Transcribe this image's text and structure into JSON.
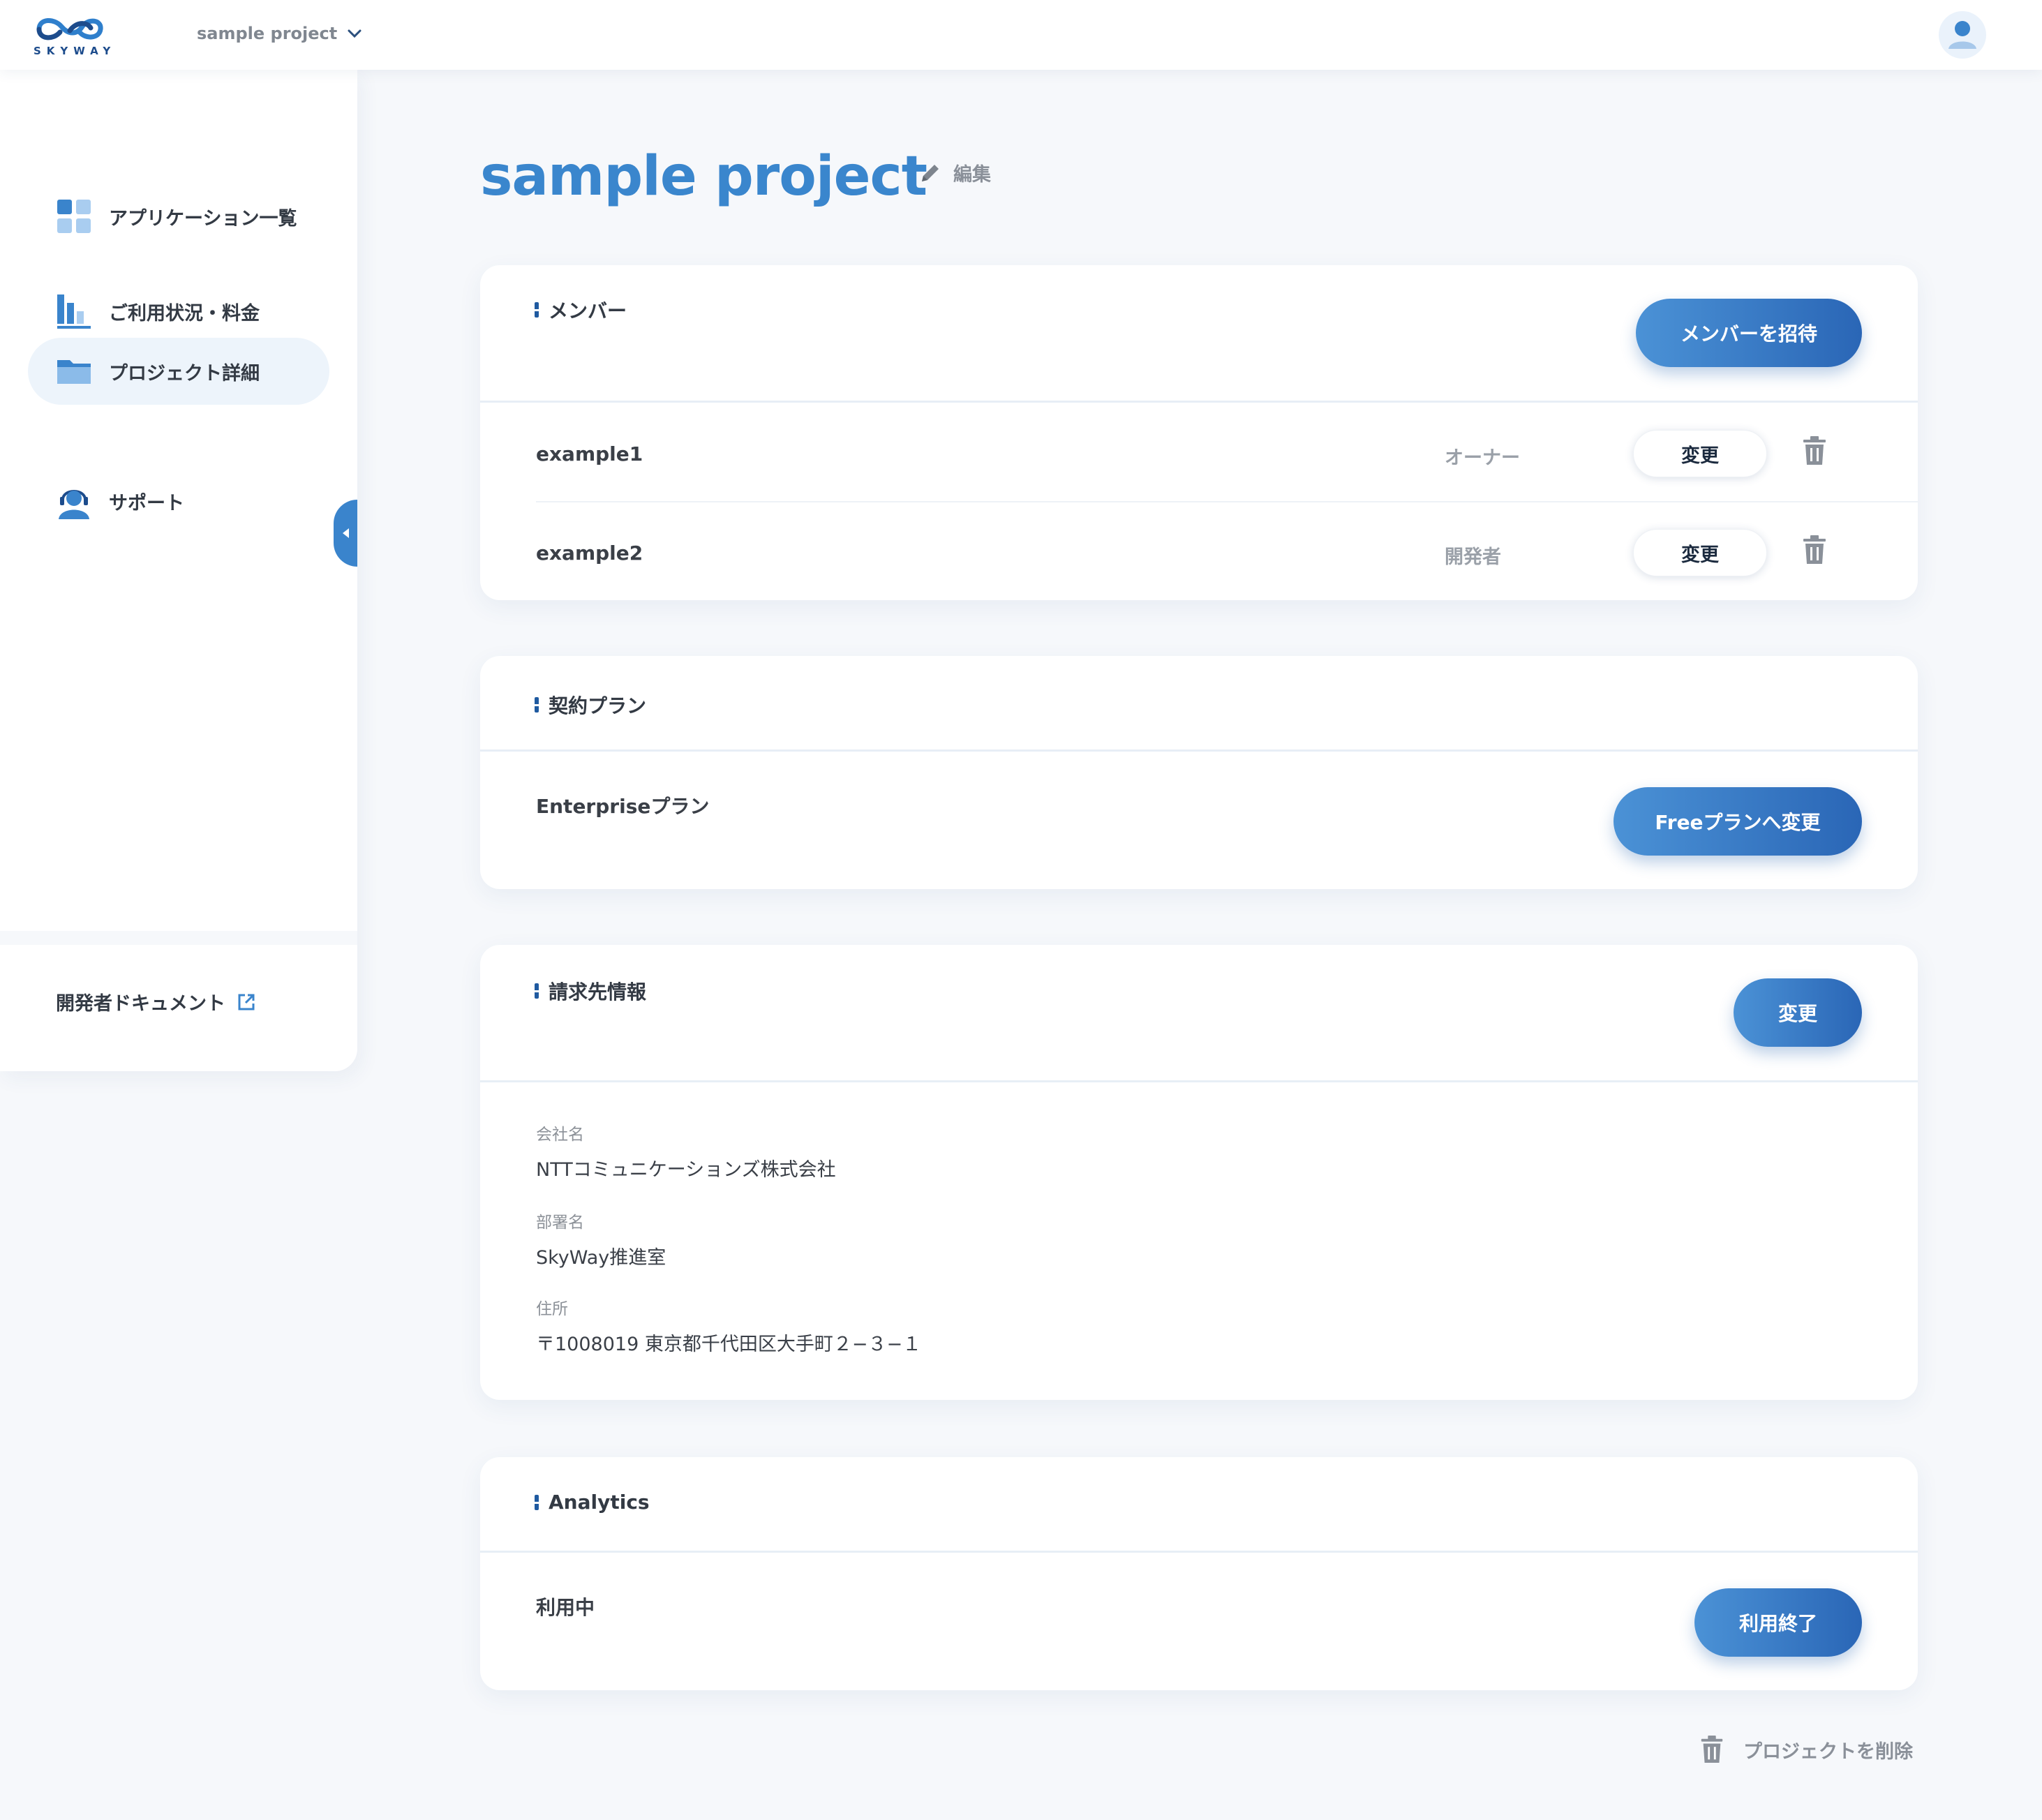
{
  "header": {
    "logo_text": "SKYWAY",
    "project_selector": "sample project"
  },
  "sidebar": {
    "items": [
      {
        "label": "アプリケーション一覧",
        "icon": "apps-grid-icon"
      },
      {
        "label": "ご利用状況・料金",
        "icon": "bar-chart-icon"
      },
      {
        "label": "プロジェクト詳細",
        "icon": "folder-icon",
        "active": true
      },
      {
        "label": "サポート",
        "icon": "support-headset-icon"
      }
    ],
    "doc_link": "開発者ドキュメント"
  },
  "main": {
    "title": "sample project",
    "edit_label": "編集",
    "members": {
      "title": "メンバー",
      "invite_button": "メンバーを招待",
      "rows": [
        {
          "name": "example1",
          "role": "オーナー",
          "change_label": "変更"
        },
        {
          "name": "example2",
          "role": "開発者",
          "change_label": "変更"
        }
      ]
    },
    "plan": {
      "title": "契約プラン",
      "current": "Enterpriseプラン",
      "change_button": "Freeプランへ変更"
    },
    "billing": {
      "title": "請求先情報",
      "change_button": "変更",
      "fields": [
        {
          "label": "会社名",
          "value": "NTTコミュニケーションズ株式会社"
        },
        {
          "label": "部署名",
          "value": "SkyWay推進室"
        },
        {
          "label": "住所",
          "value": "〒1008019 東京都千代田区大手町２−３−１"
        }
      ]
    },
    "analytics": {
      "title": "Analytics",
      "status": "利用中",
      "end_button": "利用終了"
    },
    "delete_project": "プロジェクトを削除"
  },
  "colors": {
    "accent": "#3a86cd",
    "button_gradient_start": "#4b92d6",
    "button_gradient_end": "#2a66b6",
    "background": "#f6f8fb"
  }
}
